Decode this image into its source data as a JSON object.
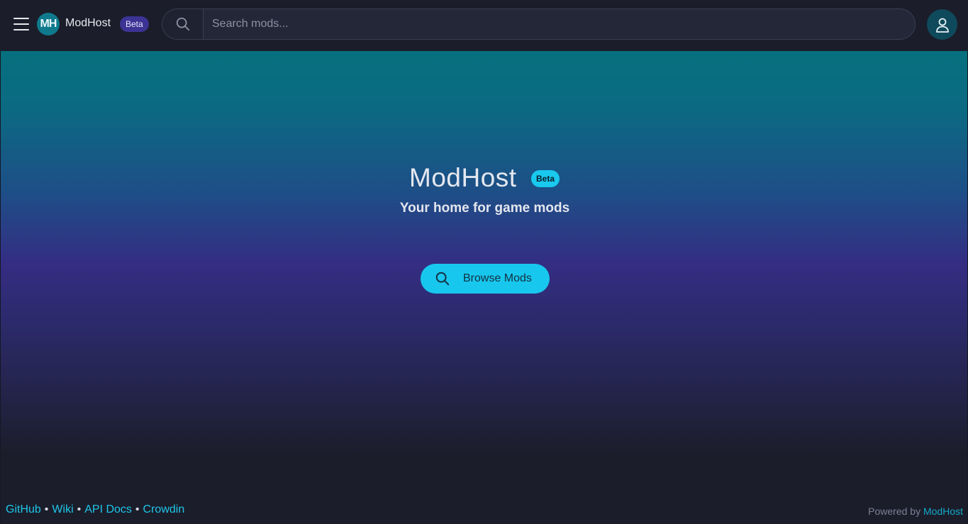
{
  "header": {
    "menu_icon": "hamburger-menu-icon",
    "logo_text": "MH",
    "brand": "ModHost",
    "beta_badge": "Beta",
    "search": {
      "placeholder": "Search mods...",
      "value": "",
      "icon": "search-icon"
    },
    "user_icon": "user-icon"
  },
  "hero": {
    "title": "ModHost",
    "beta_badge": "Beta",
    "subtitle": "Your home for game mods",
    "browse_button": {
      "label": "Browse Mods",
      "icon": "search-icon"
    }
  },
  "footer": {
    "links": [
      "GitHub",
      "Wiki",
      "API Docs",
      "Crowdin"
    ],
    "separator": "•",
    "powered_prefix": "Powered by",
    "powered_link": "ModHost"
  },
  "colors": {
    "accent": "#18c7ee",
    "beta_badge": "#3b3494",
    "link": "#1fc6ea",
    "background": "#1b1d2a"
  }
}
